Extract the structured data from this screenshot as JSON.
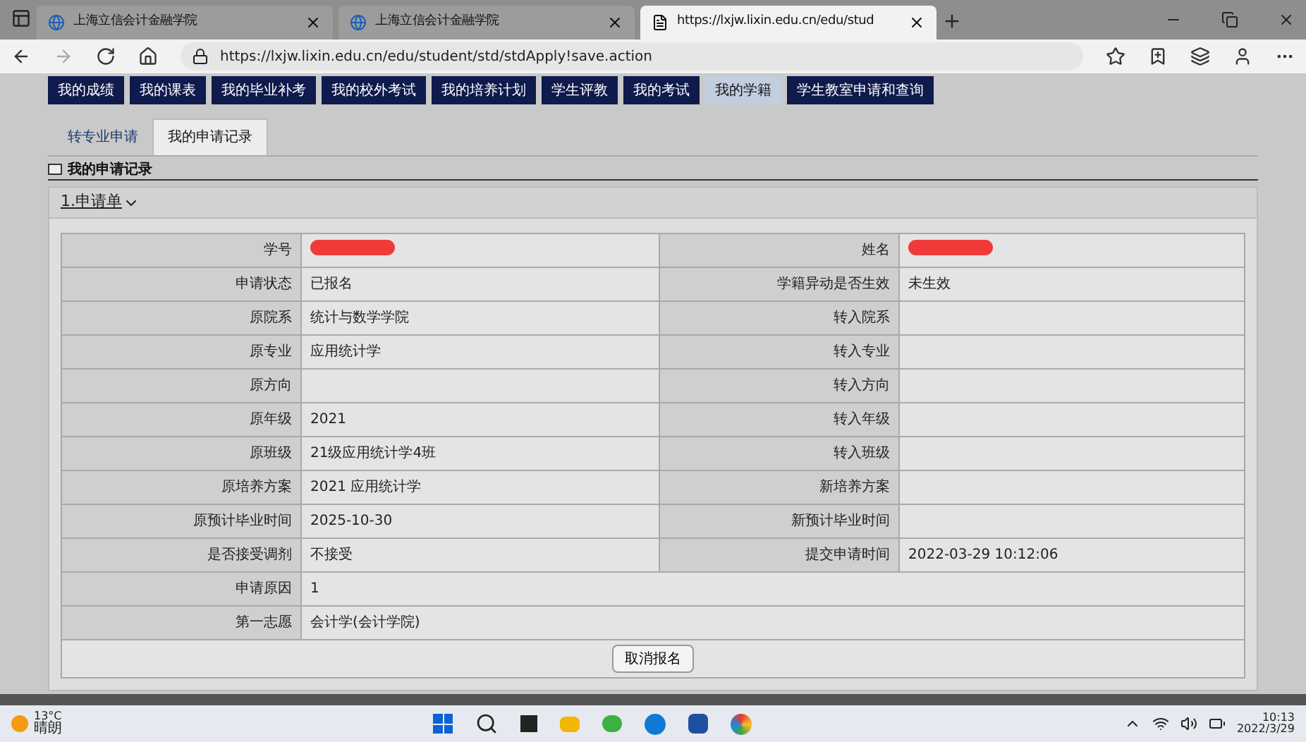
{
  "browser": {
    "tabs": [
      {
        "title": "上海立信会计金融学院",
        "selected": false
      },
      {
        "title": "上海立信会计金融学院",
        "selected": false
      },
      {
        "title": "https://lxjw.lixin.edu.cn/edu/stud",
        "selected": true
      }
    ],
    "address": "https://lxjw.lixin.edu.cn/edu/student/std/stdApply!save.action"
  },
  "nav": [
    {
      "label": "我的成绩",
      "selected": false
    },
    {
      "label": "我的课表",
      "selected": false
    },
    {
      "label": "我的毕业补考",
      "selected": false
    },
    {
      "label": "我的校外考试",
      "selected": false
    },
    {
      "label": "我的培养计划",
      "selected": false
    },
    {
      "label": "学生评教",
      "selected": false
    },
    {
      "label": "我的考试",
      "selected": false
    },
    {
      "label": "我的学籍",
      "selected": true
    },
    {
      "label": "学生教室申请和查询",
      "selected": false
    }
  ],
  "subtabs": [
    {
      "label": "转专业申请",
      "selected": false
    },
    {
      "label": "我的申请记录",
      "selected": true
    }
  ],
  "section_title": "我的申请记录",
  "panel_title": "1.申请单",
  "rows": [
    {
      "kind": "pair",
      "left_label": "学号",
      "left_redacted": true,
      "right_label": "姓名",
      "right_redacted": true
    },
    {
      "kind": "pair",
      "left_label": "申请状态",
      "left_value": "已报名",
      "right_label": "学籍异动是否生效",
      "right_value": "未生效"
    },
    {
      "kind": "pair",
      "left_label": "原院系",
      "left_value": "统计与数学学院",
      "right_label": "转入院系"
    },
    {
      "kind": "pair",
      "left_label": "原专业",
      "left_value": "应用统计学",
      "right_label": "转入专业"
    },
    {
      "kind": "pair",
      "left_label": "原方向",
      "right_label": "转入方向"
    },
    {
      "kind": "pair",
      "left_label": "原年级",
      "left_value": "2021",
      "right_label": "转入年级"
    },
    {
      "kind": "pair",
      "left_label": "原班级",
      "left_value": "21级应用统计学4班",
      "right_label": "转入班级"
    },
    {
      "kind": "pair",
      "left_label": "原培养方案",
      "left_value": "2021 应用统计学",
      "right_label": "新培养方案"
    },
    {
      "kind": "pair",
      "left_label": "原预计毕业时间",
      "left_value": "2025-10-30",
      "right_label": "新预计毕业时间"
    },
    {
      "kind": "pair",
      "left_label": "是否接受调剂",
      "left_value": "不接受",
      "right_label": "提交申请时间",
      "right_value": "2022-03-29 10:12:06"
    },
    {
      "kind": "full",
      "left_label": "申请原因",
      "left_value": "1"
    },
    {
      "kind": "full",
      "left_label": "第一志愿",
      "left_value": "会计学(会计学院)"
    }
  ],
  "action_button": "取消报名",
  "taskbar": {
    "temperature": "13°C",
    "weather": "晴朗",
    "time": "10:13",
    "date": "2022/3/29"
  }
}
